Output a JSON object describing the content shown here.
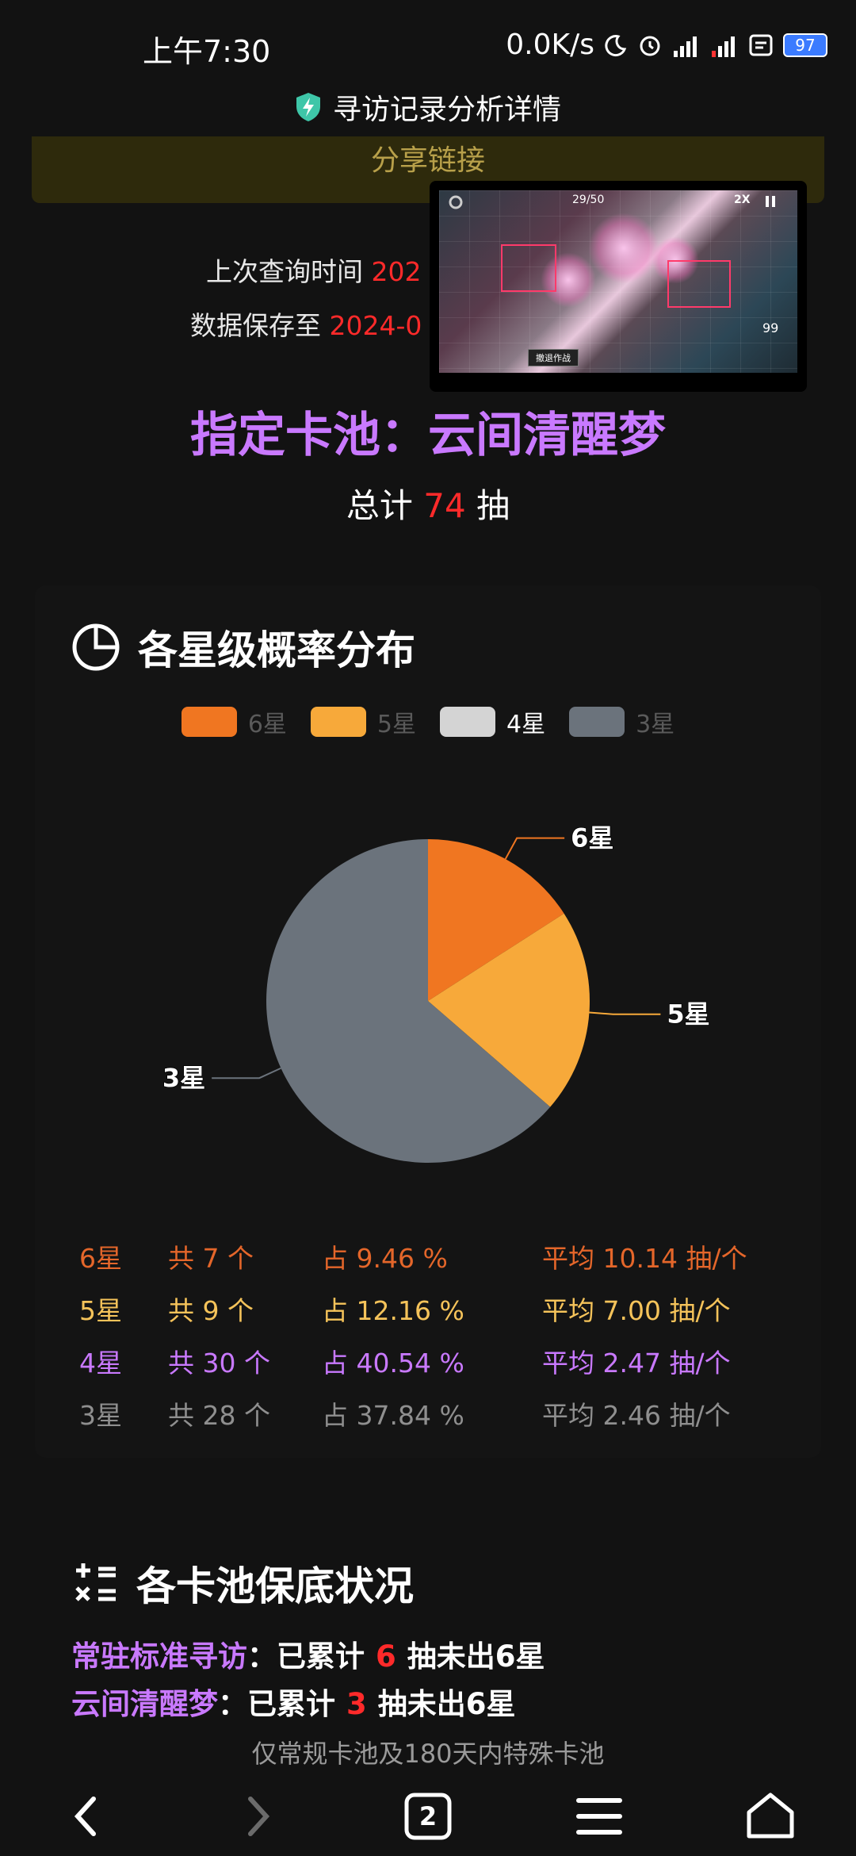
{
  "status_bar": {
    "time": "上午7:30",
    "network_speed": "0.0K/s",
    "battery": "97",
    "icons": [
      "moon-icon",
      "alarm-icon",
      "signal-icon",
      "signal-icon-2",
      "wifi-icon",
      "battery-icon"
    ]
  },
  "header": {
    "title": "寻访记录分析详情",
    "icon": "shield-lightning-icon"
  },
  "share": {
    "label": "分享链接"
  },
  "query_info": {
    "last_query_label": "上次查询时间",
    "last_query_value": "202",
    "saved_until_label": "数据保存至",
    "saved_until_value": "2024-0"
  },
  "pip_video": {
    "counter": "29/50",
    "speed": "2X",
    "cost": "99",
    "button": "撤退作战"
  },
  "pool": {
    "title": "指定卡池：云间清醒梦",
    "total_prefix": "总计",
    "total_value": "74",
    "total_suffix": "抽"
  },
  "distribution": {
    "section_title": "各星级概率分布",
    "icon": "pie-chart-icon",
    "legend": [
      {
        "label": "6星",
        "color": "#f07621",
        "active": false
      },
      {
        "label": "5星",
        "color": "#f7a93a",
        "active": false
      },
      {
        "label": "4星",
        "color": "#d4d4d4",
        "active": true
      },
      {
        "label": "3星",
        "color": "#6b737c",
        "active": false
      }
    ]
  },
  "chart_data": {
    "type": "pie",
    "title": "",
    "slices": [
      {
        "label": "6星",
        "value": 7,
        "color": "#f07621"
      },
      {
        "label": "5星",
        "value": 9,
        "color": "#f7a93a"
      },
      {
        "label": "3星",
        "value": 28,
        "color": "#6b737c"
      }
    ],
    "legend_placement": "top"
  },
  "stats": [
    {
      "star": "6星",
      "count": "共 7 个",
      "pct": "占 9.46 %",
      "avg": "平均 10.14 抽/个",
      "cls": "row6"
    },
    {
      "star": "5星",
      "count": "共 9 个",
      "pct": "占 12.16 %",
      "avg": "平均 7.00 抽/个",
      "cls": "row5"
    },
    {
      "star": "4星",
      "count": "共 30 个",
      "pct": "占 40.54 %",
      "avg": "平均 2.47 抽/个",
      "cls": "row4"
    },
    {
      "star": "3星",
      "count": "共 28 个",
      "pct": "占 37.84 %",
      "avg": "平均 2.46 抽/个",
      "cls": "row3"
    }
  ],
  "guarantee": {
    "section_title": "各卡池保底状况",
    "icon": "calculator-icon",
    "lines": [
      {
        "pool": "常驻标准寻访",
        "prefix": "：已累计",
        "value": "6",
        "suffix": "抽未出6星"
      },
      {
        "pool": "云间清醒梦",
        "prefix": "：已累计",
        "value": "3",
        "suffix": "抽未出6星"
      }
    ],
    "note": "仅常规卡池及180天内特殊卡池"
  },
  "nav": {
    "tab_count": "2"
  }
}
